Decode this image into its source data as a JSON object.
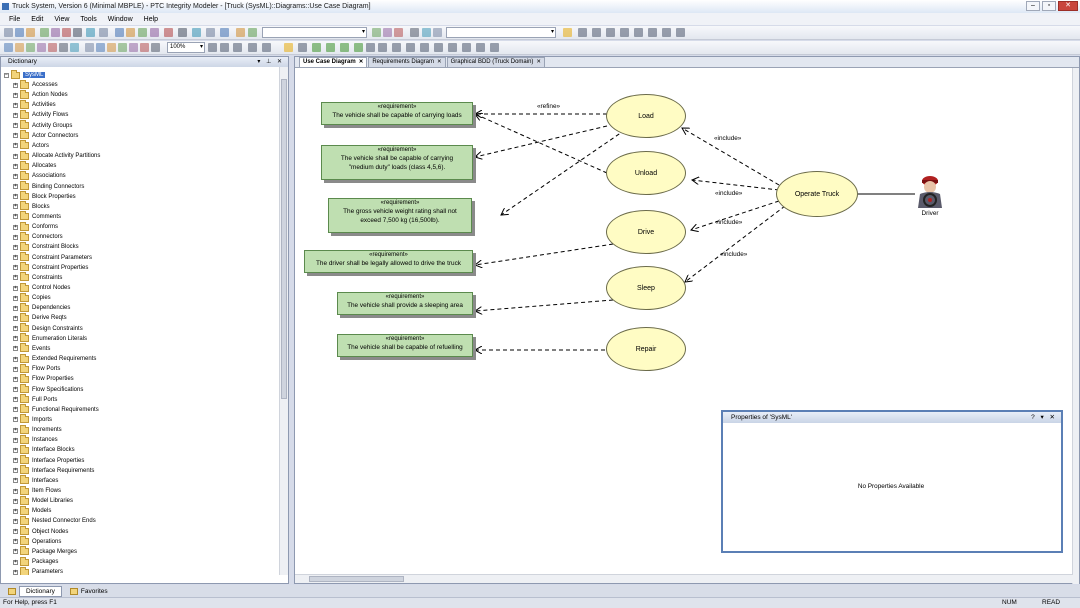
{
  "window": {
    "title": "Truck System, Version 6  (Minimal MBPLE) - PTC Integrity Modeler - [Truck (SysML)::Diagrams::Use Case Diagram]"
  },
  "menu": [
    "File",
    "Edit",
    "View",
    "Tools",
    "Window",
    "Help"
  ],
  "toolbar": {
    "zoom": "100%"
  },
  "dictionary": {
    "title": "Dictionary",
    "root": "SysML",
    "items": [
      "Accesses",
      "Action Nodes",
      "Activities",
      "Activity Flows",
      "Activity Groups",
      "Actor Connectors",
      "Actors",
      "Allocate Activity Partitions",
      "Allocates",
      "Associations",
      "Binding Connectors",
      "Block Properties",
      "Blocks",
      "Comments",
      "Conforms",
      "Connectors",
      "Constraint Blocks",
      "Constraint Parameters",
      "Constraint Properties",
      "Constraints",
      "Control Nodes",
      "Copies",
      "Dependencies",
      "Derive Reqts",
      "Design Constraints",
      "Enumeration Literals",
      "Events",
      "Extended Requirements",
      "Flow Ports",
      "Flow Properties",
      "Flow Specifications",
      "Full Ports",
      "Functional Requirements",
      "Imports",
      "Increments",
      "Instances",
      "Interface Blocks",
      "Interface Properties",
      "Interface Requirements",
      "Interfaces",
      "Item Flows",
      "Model Libraries",
      "Models",
      "Nested Connector Ends",
      "Object Nodes",
      "Operations",
      "Package Merges",
      "Packages",
      "Parameters"
    ],
    "tabs": [
      "Dictionary",
      "Favorites"
    ]
  },
  "diagram": {
    "tabs": [
      "Use Case Diagram",
      "Requirements Diagram",
      "Graphical BDD (Truck Domain)"
    ],
    "requirements": [
      {
        "stereotype": "«requirement»",
        "text": [
          "The vehicle shall be capable of carrying loads"
        ]
      },
      {
        "stereotype": "«requirement»",
        "text": [
          "The vehicle shall be capable of carrying",
          "\"medium  duty\" loads (class 4,5,6)."
        ]
      },
      {
        "stereotype": "«requirement»",
        "text": [
          "The gross vehicle weight rating shall not",
          "exceed 7,500 kg (16,500lb)."
        ]
      },
      {
        "stereotype": "«requirement»",
        "text": [
          "The driver shall be legally allowed to drive the truck"
        ]
      },
      {
        "stereotype": "«requirement»",
        "text": [
          "The vehicle shall provide a sleeping area"
        ]
      },
      {
        "stereotype": "«requirement»",
        "text": [
          "The vehicle shall be capable of refuelling"
        ]
      }
    ],
    "usecases": [
      "Load",
      "Unload",
      "Drive",
      "Sleep",
      "Repair",
      "Operate Truck"
    ],
    "relations": [
      "«refine»",
      "«include»",
      "«include»",
      "«include»",
      "«include»"
    ],
    "actor": "Driver"
  },
  "properties": {
    "title": "Properties of 'SysML'",
    "message": "No Properties Available"
  },
  "status": {
    "help": "For Help, press F1",
    "num": "NUM",
    "read": "READ"
  }
}
